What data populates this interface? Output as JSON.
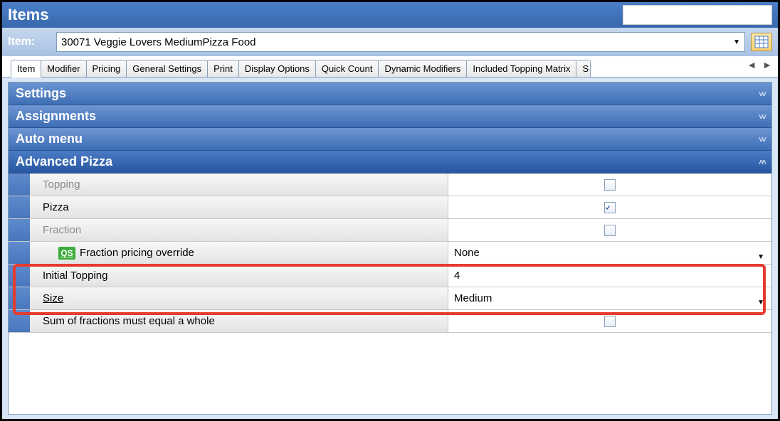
{
  "header": {
    "title": "Items"
  },
  "item_selector": {
    "label": "Item:",
    "value": "30071 Veggie Lovers MediumPizza Food"
  },
  "tabs": [
    "Item",
    "Modifier",
    "Pricing",
    "General Settings",
    "Print",
    "Display Options",
    "Quick Count",
    "Dynamic Modifiers",
    "Included Topping Matrix"
  ],
  "tab_partial": "S",
  "active_tab_index": 0,
  "sections": {
    "settings": "Settings",
    "assignments": "Assignments",
    "auto_menu": "Auto menu",
    "advanced_pizza": "Advanced Pizza"
  },
  "advanced_pizza": {
    "topping": {
      "label": "Topping",
      "checked": false
    },
    "pizza": {
      "label": "Pizza",
      "checked": true
    },
    "fraction": {
      "label": "Fraction",
      "checked": false
    },
    "fraction_pricing_override": {
      "label": "Fraction pricing override",
      "value": "None",
      "icon": "QS"
    },
    "initial_topping": {
      "label": "Initial Topping",
      "value": "4"
    },
    "size": {
      "label": "Size",
      "value": "Medium"
    },
    "sum_fractions": {
      "label": "Sum of fractions must equal a whole",
      "checked": false
    }
  }
}
